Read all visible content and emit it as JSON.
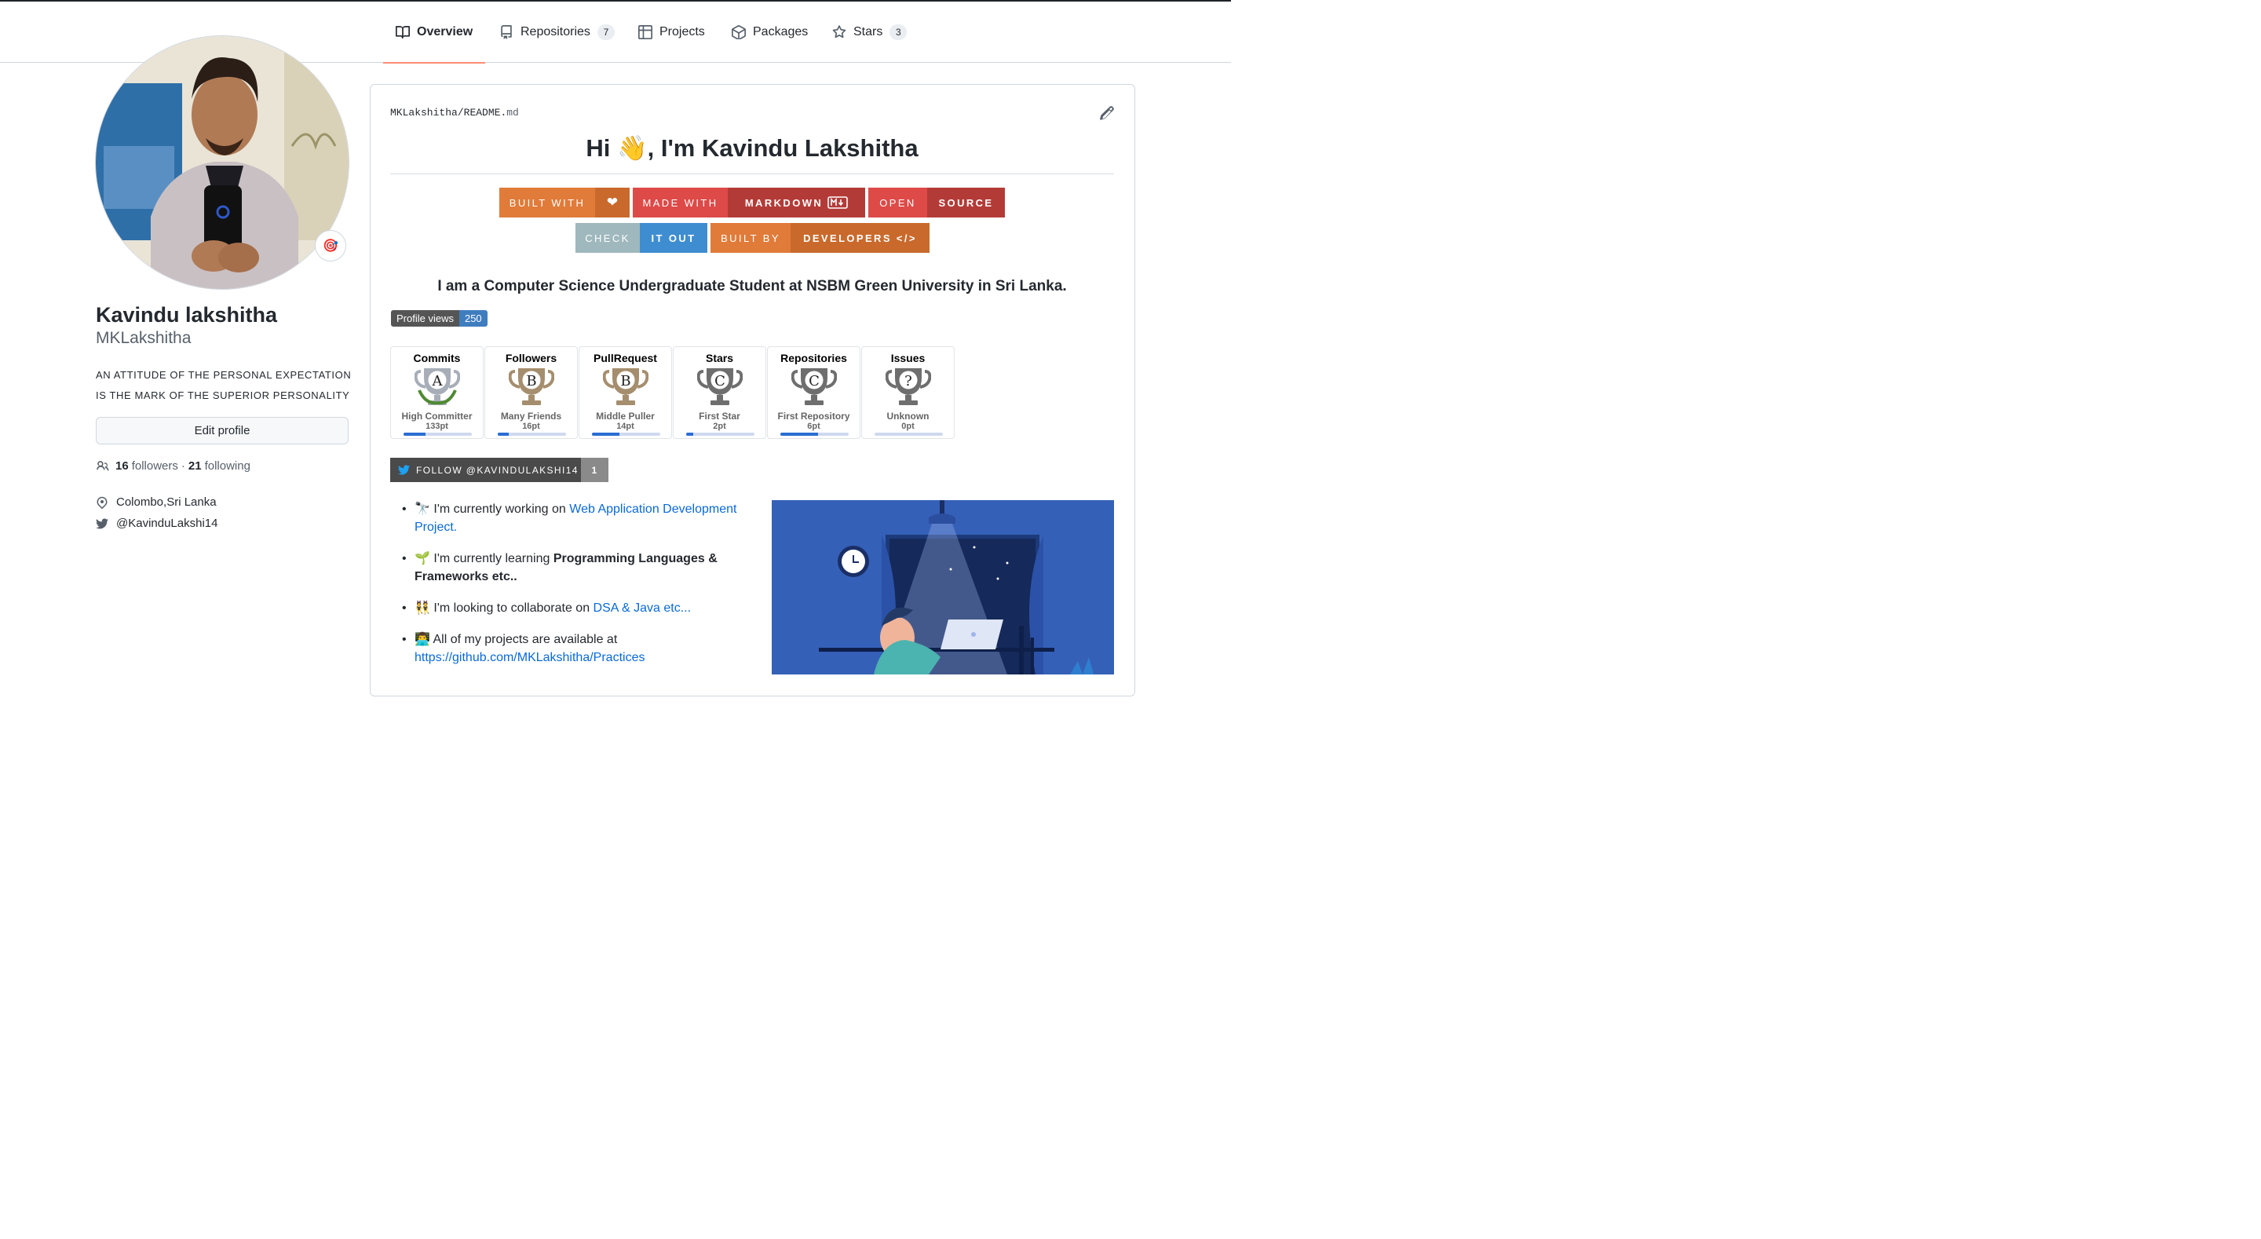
{
  "tabs": [
    {
      "label": "Overview",
      "icon": "book-icon",
      "active": true
    },
    {
      "label": "Repositories",
      "icon": "repo-icon",
      "count": "7"
    },
    {
      "label": "Projects",
      "icon": "table-icon"
    },
    {
      "label": "Packages",
      "icon": "package-icon"
    },
    {
      "label": "Stars",
      "icon": "star-icon",
      "count": "3"
    }
  ],
  "profile": {
    "full_name": "Kavindu lakshitha",
    "login": "MKLakshitha",
    "status_emoji": "🎯",
    "bio_line1": "AN ATTITUDE OF THE PERSONAL EXPECTATION",
    "bio_line2": "IS THE MARK OF THE SUPERIOR PERSONALITY",
    "edit_label": "Edit profile",
    "followers_count": "16",
    "followers_label": "followers",
    "separator": "·",
    "following_count": "21",
    "following_label": "following",
    "location": "Colombo,Sri Lanka",
    "twitter": "@KavinduLakshi14"
  },
  "readme": {
    "owner": "MKLakshitha",
    "slash": "/",
    "file_base": "README.",
    "file_ext": "md",
    "heading": "Hi 👋, I'm Kavindu Lakshitha",
    "tagline": "I am a Computer Science Undergraduate Student at NSBM Green University in Sri Lanka.",
    "badges": [
      {
        "left": "BUILT WITH",
        "right": "❤",
        "left_color": "#e07b39",
        "right_color": "#c96a2c"
      },
      {
        "left": "MADE WITH",
        "right": "MARKDOWN",
        "left_color": "#dd4a48",
        "right_color": "#b33b37"
      },
      {
        "left": "OPEN",
        "right": "SOURCE",
        "left_color": "#dd4a48",
        "right_color": "#b33b37"
      },
      {
        "left": "CHECK",
        "right": "IT OUT",
        "left_color": "#9fb8bd",
        "right_color": "#3f8dd1"
      },
      {
        "left": "BUILT BY",
        "right": "DEVELOPERS </>",
        "left_color": "#e07b39",
        "right_color": "#c96a2c"
      }
    ],
    "profile_views_label": "Profile views",
    "profile_views_count": "250",
    "trophies": [
      {
        "title": "Commits",
        "rank": "A",
        "name": "High Committer",
        "points": "133pt",
        "progress": 0.32,
        "cup_color": "#a7aeb8",
        "laurel": true
      },
      {
        "title": "Followers",
        "rank": "B",
        "name": "Many Friends",
        "points": "16pt",
        "progress": 0.16,
        "cup_color": "#a58e6e",
        "laurel": false
      },
      {
        "title": "PullRequest",
        "rank": "B",
        "name": "Middle Puller",
        "points": "14pt",
        "progress": 0.4,
        "cup_color": "#a58e6e",
        "laurel": false
      },
      {
        "title": "Stars",
        "rank": "C",
        "name": "First Star",
        "points": "2pt",
        "progress": 0.1,
        "cup_color": "#6e6e6e",
        "laurel": false
      },
      {
        "title": "Repositories",
        "rank": "C",
        "name": "First Repository",
        "points": "6pt",
        "progress": 0.55,
        "cup_color": "#6e6e6e",
        "laurel": false
      },
      {
        "title": "Issues",
        "rank": "?",
        "name": "Unknown",
        "points": "0pt",
        "progress": 0.0,
        "cup_color": "#6e6e6e",
        "laurel": false
      }
    ],
    "twitter_follow_label": "FOLLOW @KAVINDULAKSHI14",
    "twitter_follow_count": "1",
    "bullets": [
      {
        "emoji": "🔭",
        "text": "I'm currently working on ",
        "link": "Web Application Development Project."
      },
      {
        "emoji": "🌱",
        "text": "I'm currently learning ",
        "bold": "Programming Languages & Frameworks etc.."
      },
      {
        "emoji": "👯",
        "text": "I'm looking to collaborate on ",
        "link": "DSA & Java etc..."
      },
      {
        "emoji": "👨‍💻",
        "text": "All of my projects are available at ",
        "link": "https://github.com/MKLakshitha/Practices"
      }
    ]
  }
}
